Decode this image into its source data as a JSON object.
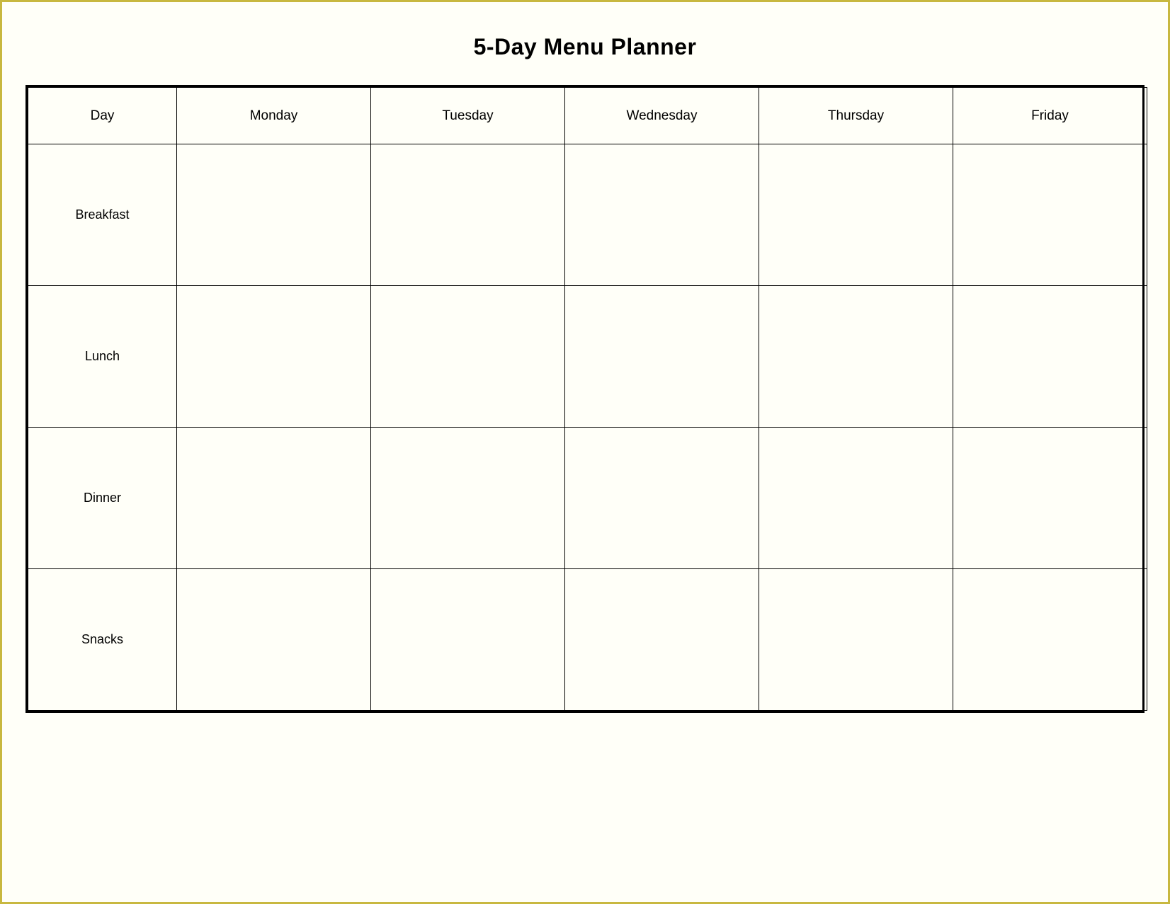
{
  "title": "5-Day Menu Planner",
  "columns": [
    {
      "id": "day",
      "label": "Day"
    },
    {
      "id": "monday",
      "label": "Monday"
    },
    {
      "id": "tuesday",
      "label": "Tuesday"
    },
    {
      "id": "wednesday",
      "label": "Wednesday"
    },
    {
      "id": "thursday",
      "label": "Thursday"
    },
    {
      "id": "friday",
      "label": "Friday"
    }
  ],
  "rows": [
    {
      "meal": "Breakfast"
    },
    {
      "meal": "Lunch"
    },
    {
      "meal": "Dinner"
    },
    {
      "meal": "Snacks"
    }
  ]
}
